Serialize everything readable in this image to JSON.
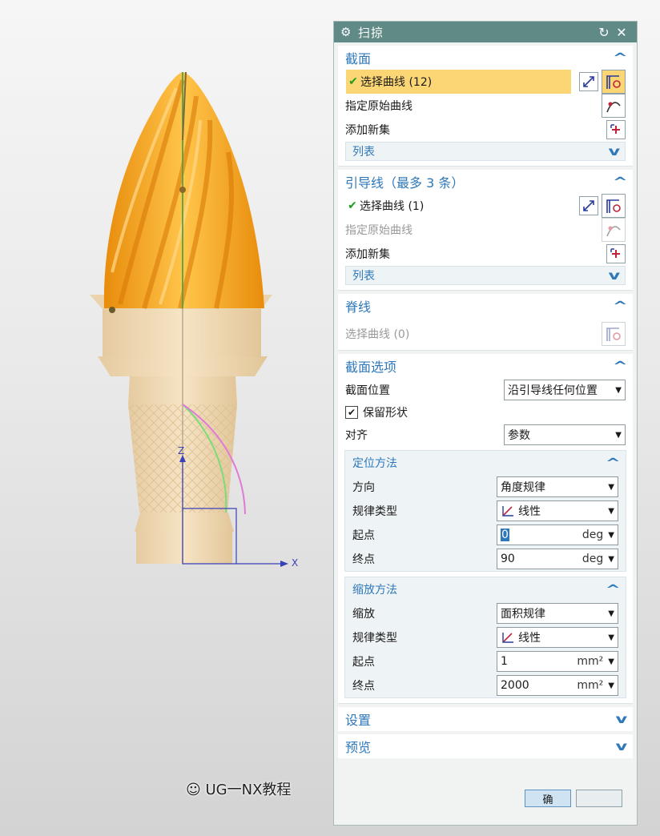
{
  "dialog": {
    "title": "扫掠",
    "icons": {
      "title": "gear-icon",
      "reset": "reset-icon",
      "close": "close-icon"
    }
  },
  "section": {
    "title": "截面",
    "select_curve": "选择曲线 (12)",
    "specify_origin": "指定原始曲线",
    "add_new_set": "添加新集",
    "list": "列表"
  },
  "guide": {
    "title": "引导线（最多 3 条）",
    "select_curve": "选择曲线 (1)",
    "specify_origin": "指定原始曲线",
    "add_new_set": "添加新集",
    "list": "列表"
  },
  "spine": {
    "title": "脊线",
    "select_curve": "选择曲线 (0)"
  },
  "section_options": {
    "title": "截面选项",
    "position_label": "截面位置",
    "position_value": "沿引导线任何位置",
    "preserve_shape": "保留形状",
    "preserve_shape_checked": true,
    "align_label": "对齐",
    "align_value": "参数",
    "orientation": {
      "title": "定位方法",
      "direction_label": "方向",
      "direction_value": "角度规律",
      "law_type_label": "规律类型",
      "law_type_value": "线性",
      "start_label": "起点",
      "start_value": "0",
      "start_unit": "deg",
      "end_label": "终点",
      "end_value": "90",
      "end_unit": "deg"
    },
    "scaling": {
      "title": "缩放方法",
      "scale_label": "缩放",
      "scale_value": "面积规律",
      "law_type_label": "规律类型",
      "law_type_value": "线性",
      "start_label": "起点",
      "start_value": "1",
      "start_unit": "mm²",
      "end_label": "终点",
      "end_value": "2000",
      "end_unit": "mm²"
    }
  },
  "settings": {
    "title": "设置"
  },
  "preview": {
    "title": "预览"
  },
  "footer": {
    "ok_partial": "确",
    "watermark": "UG一NX教程"
  },
  "viewport": {
    "axis_x": "X",
    "axis_z": "Z"
  },
  "colors": {
    "title_bar": "#5f8a86",
    "group_title": "#2f78b9",
    "selection_highlight": "#fcd675",
    "ice_cream": "#f7a51b",
    "cone": "#f0dbb6"
  }
}
